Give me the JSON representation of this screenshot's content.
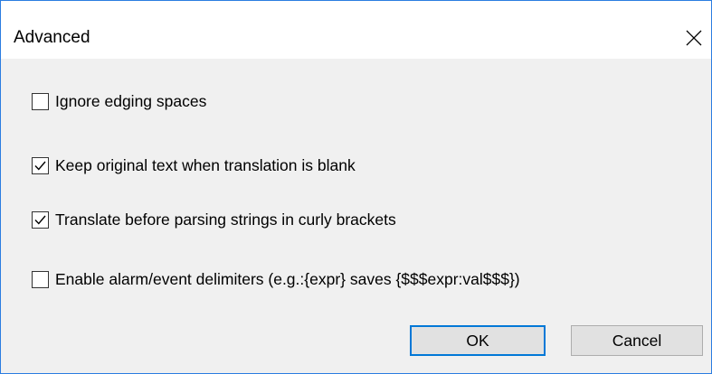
{
  "window": {
    "title": "Advanced",
    "close_glyph": "close-icon"
  },
  "options": [
    {
      "label": "Ignore edging spaces",
      "checked": false
    },
    {
      "label": "Keep original text when translation is blank",
      "checked": true
    },
    {
      "label": "Translate before parsing strings in curly brackets",
      "checked": true
    },
    {
      "label": "Enable alarm/event delimiters (e.g.:{expr} saves {$$$expr:val$$$})",
      "checked": false
    }
  ],
  "buttons": {
    "ok_label": "OK",
    "cancel_label": "Cancel"
  },
  "colors": {
    "accent": "#0078d7",
    "window_border": "#2b7de1",
    "dialog_bg": "#f0f0f0",
    "button_bg": "#e1e1e1"
  }
}
